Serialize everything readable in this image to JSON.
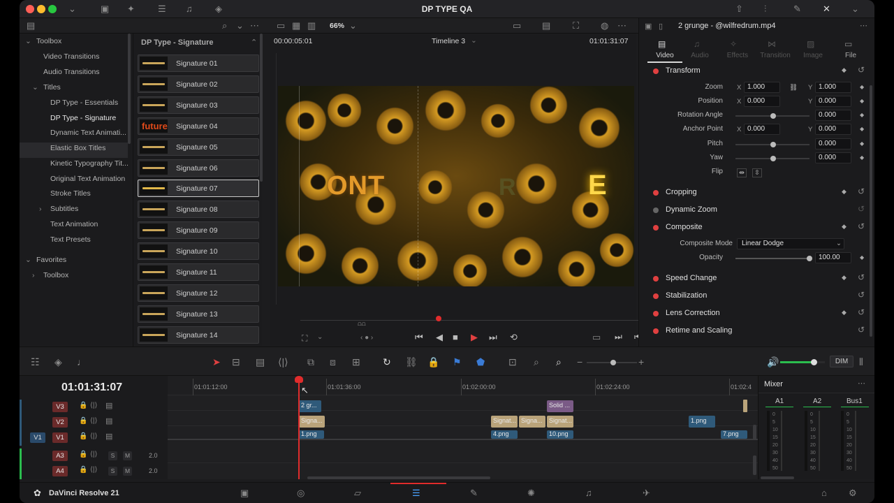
{
  "app": {
    "title": "DP TYPE QA",
    "brand": "DaVinci Resolve 21"
  },
  "toolbar2": {
    "zoom": "66%"
  },
  "toolbox": {
    "items": [
      {
        "label": "Toolbox",
        "level": 0
      },
      {
        "label": "Video Transitions",
        "level": 1
      },
      {
        "label": "Audio Transitions",
        "level": 1
      },
      {
        "label": "Titles",
        "level": 1
      },
      {
        "label": "DP Type - Essentials",
        "level": 2
      },
      {
        "label": "DP Type - Signature",
        "level": 2,
        "selected": true
      },
      {
        "label": "Dynamic Text Animati...",
        "level": 2
      },
      {
        "label": "Elastic Box Titles",
        "level": 2
      },
      {
        "label": "Kinetic Typography Tit...",
        "level": 2
      },
      {
        "label": "Original Text Animation",
        "level": 2
      },
      {
        "label": "Stroke Titles",
        "level": 2
      },
      {
        "label": "Subtitles",
        "level": 2
      },
      {
        "label": "Text Animation",
        "level": 2
      },
      {
        "label": "Text Presets",
        "level": 2
      },
      {
        "label": "Favorites",
        "level": 0
      },
      {
        "label": "Toolbox",
        "level": 1
      }
    ]
  },
  "library": {
    "title": "DP Type - Signature",
    "items": [
      "Signature 01",
      "Signature 02",
      "Signature 03",
      "Signature 04",
      "Signature 05",
      "Signature 06",
      "Signature 07",
      "Signature 08",
      "Signature 09",
      "Signature 10",
      "Signature 11",
      "Signature 12",
      "Signature 13",
      "Signature 14"
    ],
    "thumb_texts": {
      "s4": "future"
    },
    "selected_index": 6
  },
  "viewer": {
    "timecode_left": "00:00:05:01",
    "timeline_name": "Timeline 3",
    "timecode_right": "01:01:31:07",
    "overlay_text_1": "ONT",
    "overlay_text_2": "R",
    "overlay_text_3": "E"
  },
  "inspector": {
    "clip_name": "2 grunge - @wilfredrum.mp4",
    "tabs": [
      "Video",
      "Audio",
      "Effects",
      "Transition",
      "Image",
      "File"
    ],
    "active_tab": "Video",
    "transform": {
      "title": "Transform",
      "zoom_label": "Zoom",
      "zoom_x": "1.000",
      "zoom_y": "1.000",
      "position_label": "Position",
      "position_x": "0.000",
      "position_y": "0.000",
      "rotation_label": "Rotation Angle",
      "rotation": "0.000",
      "anchor_label": "Anchor Point",
      "anchor_x": "0.000",
      "anchor_y": "0.000",
      "pitch_label": "Pitch",
      "pitch": "0.000",
      "yaw_label": "Yaw",
      "yaw": "0.000",
      "flip_label": "Flip",
      "x_axis": "X",
      "y_axis": "Y"
    },
    "cropping": "Cropping",
    "dynamic_zoom": "Dynamic Zoom",
    "composite": {
      "title": "Composite",
      "mode_label": "Composite Mode",
      "mode_value": "Linear Dodge",
      "opacity_label": "Opacity",
      "opacity_value": "100.00"
    },
    "speed_change": "Speed Change",
    "stabilization": "Stabilization",
    "lens_correction": "Lens Correction",
    "retime": "Retime and Scaling"
  },
  "timeline": {
    "timecode": "01:01:31:07",
    "ruler_labels": [
      "01:01:12:00",
      "01:01:36:00",
      "01:02:00:00",
      "01:02:24:00",
      "01:02:4"
    ],
    "tracks": [
      {
        "label": "V3",
        "type": "video"
      },
      {
        "label": "V2",
        "type": "video"
      },
      {
        "label": "V1",
        "patch": "V1",
        "type": "video"
      },
      {
        "label": "A3",
        "type": "audio",
        "s": "S",
        "m": "M",
        "level": "2.0"
      },
      {
        "label": "A4",
        "type": "audio",
        "s": "S",
        "m": "M",
        "level": "2.0"
      }
    ],
    "clips": {
      "v3_a": "2 gr...",
      "v3_b": "Solid ...",
      "v2_a": "Signa...",
      "v2_b": "Signat...",
      "v2_c": "Signa...",
      "v2_d": "Signat...",
      "v2_e": "1.png",
      "v1_a": "1.png",
      "v1_b": "4.png",
      "v1_c": "10.png",
      "v1_d": "7.png"
    }
  },
  "audio": {
    "dim": "DIM",
    "volume": 0.75
  },
  "mixer": {
    "title": "Mixer",
    "channels": [
      "A1",
      "A2",
      "Bus1"
    ],
    "scale": [
      "0",
      "5",
      "10",
      "15",
      "20",
      "30",
      "40",
      "50"
    ]
  },
  "colors": {
    "accent_red": "#e04040",
    "playhead": "#e02c2c",
    "clip_blue": "#2f5a7a",
    "clip_tan": "#b9a37a",
    "clip_purple": "#7a5a86"
  }
}
